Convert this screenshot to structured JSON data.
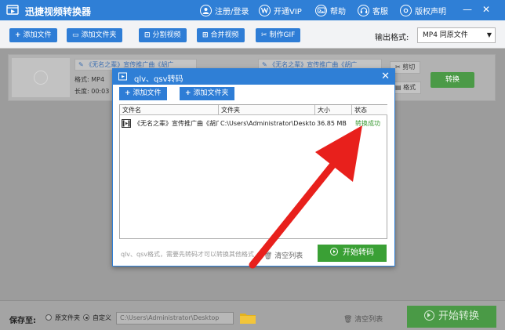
{
  "window": {
    "title": "迅捷视频转换器",
    "nav": [
      {
        "label": "注册/登录",
        "icon": "user-icon"
      },
      {
        "label": "开通VIP",
        "icon": "vip-icon"
      },
      {
        "label": "帮助",
        "icon": "help-icon"
      },
      {
        "label": "客服",
        "icon": "headset-icon"
      },
      {
        "label": "版权声明",
        "icon": "copyright-icon"
      }
    ]
  },
  "toolbar": {
    "add_file": "添加文件",
    "add_folder": "添加文件夹",
    "split_video": "分割视频",
    "merge_video": "合并视频",
    "make_gif": "制作GIF",
    "output_format_label": "输出格式:",
    "output_format_value": "MP4  同原文件"
  },
  "file_item": {
    "name_left": "《无名之辈》宣传推广曲《胡广",
    "name_right": "《无名之辈》宣传推广曲《胡广",
    "format_label": "格式:",
    "format_value": "MP4",
    "duration_label": "长度:",
    "duration_value": "00:03",
    "cut_label": "剪切",
    "format_btn_label": "格式",
    "convert_label": "转换"
  },
  "dialog": {
    "title": "qlv、qsv转码",
    "add_file": "添加文件",
    "add_folder": "添加文件夹",
    "columns": {
      "name": "文件名",
      "folder": "文件夹",
      "size": "大小",
      "status": "状态"
    },
    "rows": [
      {
        "name": "《无名之辈》宣传推广曲《胡广",
        "folder": "C:\\Users\\Administrator\\Desktop",
        "size": "36.85 MB",
        "status": "转换成功"
      }
    ],
    "hint": "qlv、qsv格式，需要先转码才可以转换其他格式",
    "clear_list": "清空列表",
    "start": "开始转码"
  },
  "bottom": {
    "save_to": "保存至:",
    "radio_source": "原文件夹",
    "radio_custom": "自定义",
    "path": "C:\\Users\\Administrator\\Desktop",
    "clear_list": "清空列表",
    "start": "开始转换"
  },
  "colors": {
    "brand_blue": "#2f7fd6",
    "success_green": "#3aa035",
    "annotation_red": "#e8201c"
  }
}
